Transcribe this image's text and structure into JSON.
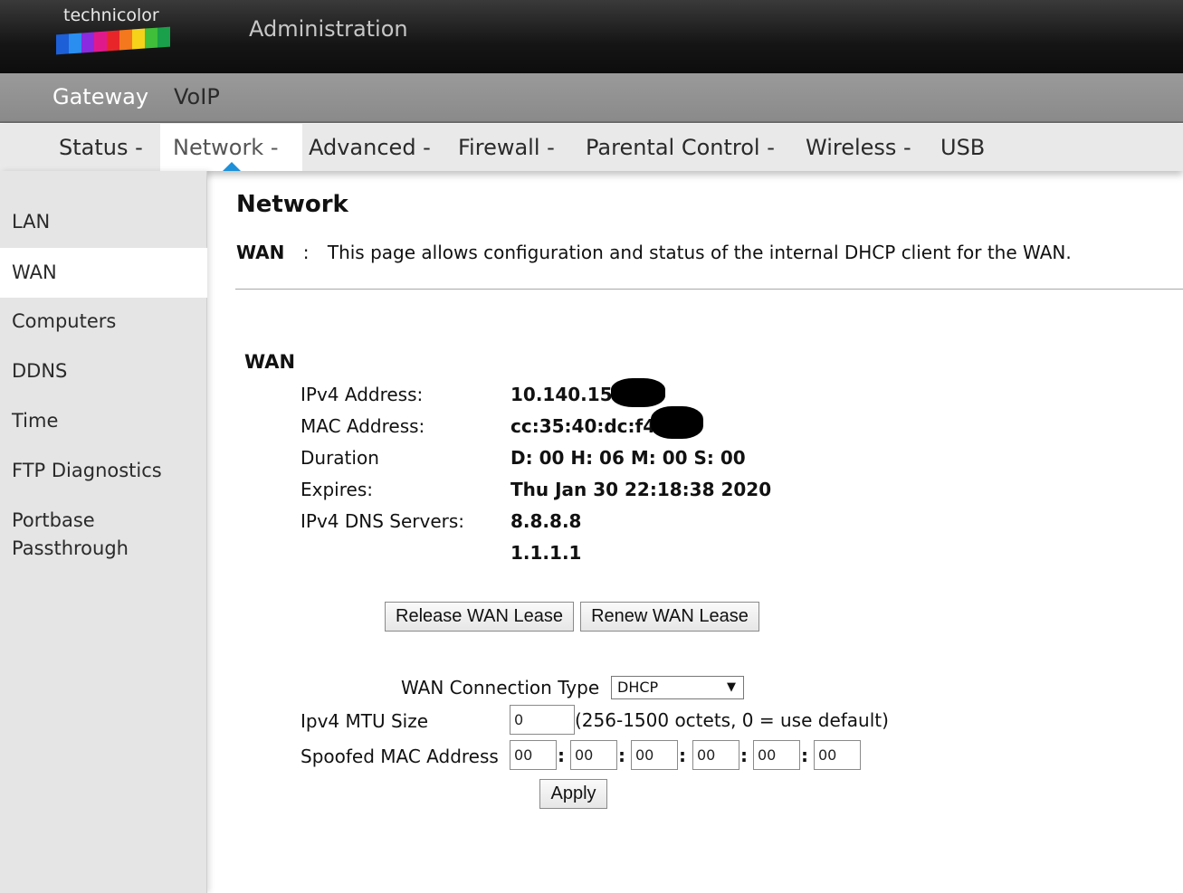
{
  "brand": {
    "logo_text": "technicolor",
    "logo_colors": [
      "#1d5fd6",
      "#2a8ef0",
      "#8a2be2",
      "#e0198a",
      "#e8262a",
      "#f3781e",
      "#f6d21b",
      "#3fbf3a",
      "#1aa04a"
    ],
    "app_title": "Administration"
  },
  "sections": [
    {
      "label": "Gateway",
      "active": true
    },
    {
      "label": "VoIP",
      "active": false
    }
  ],
  "subnav": [
    {
      "label": "Status -"
    },
    {
      "label": "Network -"
    },
    {
      "label": "Advanced -"
    },
    {
      "label": "Firewall -"
    },
    {
      "label": "Parental Control -"
    },
    {
      "label": "Wireless -"
    },
    {
      "label": "USB"
    }
  ],
  "subnav_active": "Network -",
  "sidebar": [
    {
      "label": "LAN"
    },
    {
      "label": "WAN"
    },
    {
      "label": "Computers"
    },
    {
      "label": "DDNS"
    },
    {
      "label": "Time"
    },
    {
      "label": "FTP Diagnostics"
    },
    {
      "label": "Portbase"
    },
    {
      "label": "Passthrough"
    }
  ],
  "sidebar_active": "WAN",
  "page": {
    "title": "Network",
    "desc_key": "WAN",
    "desc_sep": ":",
    "desc_text": "This page allows configuration and status of the internal DHCP client for the WAN."
  },
  "wan": {
    "heading": "WAN",
    "fields": [
      {
        "label": "IPv4 Address:",
        "value": "10.140.15"
      },
      {
        "label": "MAC Address:",
        "value": "cc:35:40:dc:f4"
      },
      {
        "label": "Duration",
        "value": "D: 00 H: 06 M: 00 S: 00"
      },
      {
        "label": "Expires:",
        "value": "Thu Jan 30 22:18:38 2020"
      },
      {
        "label": "IPv4 DNS Servers:",
        "value": "8.8.8.8"
      },
      {
        "label": "",
        "value": "1.1.1.1"
      }
    ],
    "release_button": "Release WAN Lease",
    "renew_button": "Renew WAN Lease"
  },
  "form": {
    "conn_type_label": "WAN Connection Type",
    "conn_type_value": "DHCP",
    "mtu_label": "Ipv4 MTU Size",
    "mtu_value": "0",
    "mtu_hint": "(256-1500 octets, 0 = use default)",
    "mac_label": "Spoofed MAC Address",
    "mac_octets": [
      "00",
      "00",
      "00",
      "00",
      "00",
      "00"
    ],
    "mac_separator": ":",
    "apply_button": "Apply"
  }
}
